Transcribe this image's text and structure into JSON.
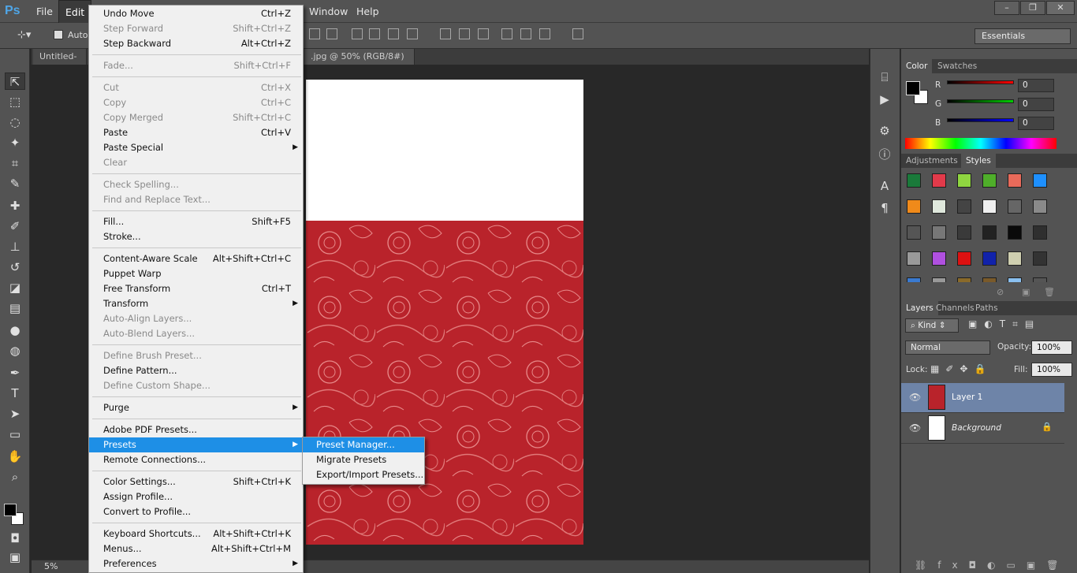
{
  "app": {
    "logo": "Ps"
  },
  "menubar": {
    "items": [
      "File",
      "Edit",
      "Window",
      "Help"
    ]
  },
  "window_controls": {
    "minimize": "–",
    "restore": "❐",
    "close": "✕"
  },
  "options_bar": {
    "auto_select_label": "Auto-",
    "workspace": "Essentials"
  },
  "tabs": [
    {
      "label": "Untitled-1 @"
    },
    {
      "label": ".jpg @ 50% (RGB/8#) *"
    },
    {
      "close": "×"
    }
  ],
  "status": {
    "zoom": "5%"
  },
  "edit_menu": {
    "groups": [
      [
        {
          "label": "Undo Move",
          "shortcut": "Ctrl+Z",
          "enabled": true
        },
        {
          "label": "Step Forward",
          "shortcut": "Shift+Ctrl+Z",
          "enabled": false
        },
        {
          "label": "Step Backward",
          "shortcut": "Alt+Ctrl+Z",
          "enabled": true
        }
      ],
      [
        {
          "label": "Fade...",
          "shortcut": "Shift+Ctrl+F",
          "enabled": false
        }
      ],
      [
        {
          "label": "Cut",
          "shortcut": "Ctrl+X",
          "enabled": false
        },
        {
          "label": "Copy",
          "shortcut": "Ctrl+C",
          "enabled": false
        },
        {
          "label": "Copy Merged",
          "shortcut": "Shift+Ctrl+C",
          "enabled": false
        },
        {
          "label": "Paste",
          "shortcut": "Ctrl+V",
          "enabled": true
        },
        {
          "label": "Paste Special",
          "shortcut": "",
          "enabled": true,
          "submenu": true
        },
        {
          "label": "Clear",
          "shortcut": "",
          "enabled": false
        }
      ],
      [
        {
          "label": "Check Spelling...",
          "shortcut": "",
          "enabled": false
        },
        {
          "label": "Find and Replace Text...",
          "shortcut": "",
          "enabled": false
        }
      ],
      [
        {
          "label": "Fill...",
          "shortcut": "Shift+F5",
          "enabled": true
        },
        {
          "label": "Stroke...",
          "shortcut": "",
          "enabled": true
        }
      ],
      [
        {
          "label": "Content-Aware Scale",
          "shortcut": "Alt+Shift+Ctrl+C",
          "enabled": true
        },
        {
          "label": "Puppet Warp",
          "shortcut": "",
          "enabled": true
        },
        {
          "label": "Free Transform",
          "shortcut": "Ctrl+T",
          "enabled": true
        },
        {
          "label": "Transform",
          "shortcut": "",
          "enabled": true,
          "submenu": true
        },
        {
          "label": "Auto-Align Layers...",
          "shortcut": "",
          "enabled": false
        },
        {
          "label": "Auto-Blend Layers...",
          "shortcut": "",
          "enabled": false
        }
      ],
      [
        {
          "label": "Define Brush Preset...",
          "shortcut": "",
          "enabled": false
        },
        {
          "label": "Define Pattern...",
          "shortcut": "",
          "enabled": true
        },
        {
          "label": "Define Custom Shape...",
          "shortcut": "",
          "enabled": false
        }
      ],
      [
        {
          "label": "Purge",
          "shortcut": "",
          "enabled": true,
          "submenu": true
        }
      ],
      [
        {
          "label": "Adobe PDF Presets...",
          "shortcut": "",
          "enabled": true
        },
        {
          "label": "Presets",
          "shortcut": "",
          "enabled": true,
          "submenu": true,
          "highlight": true
        },
        {
          "label": "Remote Connections...",
          "shortcut": "",
          "enabled": true
        }
      ],
      [
        {
          "label": "Color Settings...",
          "shortcut": "Shift+Ctrl+K",
          "enabled": true
        },
        {
          "label": "Assign Profile...",
          "shortcut": "",
          "enabled": true
        },
        {
          "label": "Convert to Profile...",
          "shortcut": "",
          "enabled": true
        }
      ],
      [
        {
          "label": "Keyboard Shortcuts...",
          "shortcut": "Alt+Shift+Ctrl+K",
          "enabled": true
        },
        {
          "label": "Menus...",
          "shortcut": "Alt+Shift+Ctrl+M",
          "enabled": true
        },
        {
          "label": "Preferences",
          "shortcut": "",
          "enabled": true,
          "submenu": true
        }
      ]
    ]
  },
  "presets_submenu": [
    {
      "label": "Preset Manager...",
      "highlight": true
    },
    {
      "label": "Migrate Presets",
      "highlight": false
    },
    {
      "label": "Export/Import Presets...",
      "highlight": false
    }
  ],
  "color_panel": {
    "tabs": [
      "Color",
      "Swatches"
    ],
    "channels": [
      {
        "name": "R",
        "value": "0",
        "color": "#e01010"
      },
      {
        "name": "G",
        "value": "0",
        "color": "#10c010"
      },
      {
        "name": "B",
        "value": "0",
        "color": "#1010e0"
      }
    ]
  },
  "styles_panel": {
    "tabs": [
      "Adjustments",
      "Styles"
    ],
    "swatches": [
      "#1a7a3a",
      "#e23a4a",
      "#8fd640",
      "#4fae2a",
      "#e86a5a",
      "#1e90ff",
      "#f08a1a",
      "#dfe8dc",
      "#444444",
      "#f0f0f0",
      "#666666",
      "#8a8a8a",
      "#555555",
      "#777777",
      "#3a3a3a",
      "#222222",
      "#0a0a0a",
      "#2f2f2f",
      "#9a9a9a",
      "#b050e0",
      "#dd1111",
      "#1122aa",
      "#cfcfb0",
      "#333333",
      "#3a7ad0",
      "#999999",
      "#8a6a2a",
      "#7a5a2a",
      "#8ac0f0",
      "#555555"
    ]
  },
  "layers_panel": {
    "tabs": [
      "Layers",
      "Channels",
      "Paths"
    ],
    "kind": "Kind",
    "blend_mode": "Normal",
    "opacity_label": "Opacity:",
    "opacity": "100%",
    "lock_label": "Lock:",
    "fill_label": "Fill:",
    "fill": "100%",
    "layers": [
      {
        "name": "Layer 1",
        "selected": true
      },
      {
        "name": "Background",
        "selected": false
      }
    ]
  }
}
